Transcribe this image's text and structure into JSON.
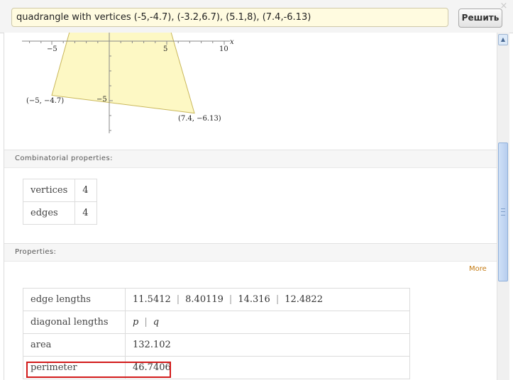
{
  "search": {
    "query": "quadrangle with vertices (-5,-4.7), (-3.2,6.7), (5.1,8), (7.4,-6.13)",
    "submit_label": "Решить",
    "close_glyph": "×"
  },
  "plot": {
    "x_axis_label": "x",
    "x_ticks": [
      "−5",
      "5",
      "10"
    ],
    "y_ticks": [
      "−5"
    ],
    "vertex_labels": [
      "(−5, −4.7)",
      "(7.4, −6.13)"
    ],
    "fill_color": "#fdf8c4",
    "stroke_color": "#c9b75a"
  },
  "combinatorial": {
    "title": "Combinatorial properties:",
    "rows": [
      {
        "key": "vertices",
        "value": "4"
      },
      {
        "key": "edges",
        "value": "4"
      }
    ]
  },
  "properties": {
    "title": "Properties:",
    "more_label": "More",
    "edge_lengths_key": "edge lengths",
    "edge_lengths": [
      "11.5412",
      "8.40119",
      "14.316",
      "12.4822"
    ],
    "diagonal_lengths_key": "diagonal lengths",
    "diagonal_lengths": [
      "p",
      "q"
    ],
    "area_key": "area",
    "area_value": "132.102",
    "perimeter_key": "perimeter",
    "perimeter_value": "46.7406",
    "separator": "|"
  },
  "colors": {
    "highlight": "#d21a1a",
    "more_link": "#c47a12",
    "search_background": "#fffbe0"
  }
}
